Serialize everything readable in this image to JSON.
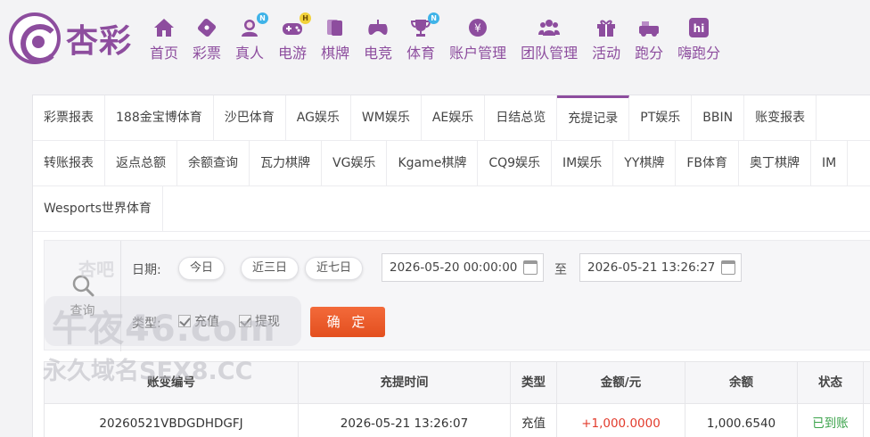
{
  "brand": {
    "name": "杏彩",
    "color": "#8d4d9e"
  },
  "nav": [
    {
      "label": "首页",
      "icon": "home-icon"
    },
    {
      "label": "彩票",
      "icon": "lottery-ticket-icon"
    },
    {
      "label": "真人",
      "icon": "live-dealer-icon",
      "badge": "N"
    },
    {
      "label": "电游",
      "icon": "gamepad-icon",
      "badge": "H"
    },
    {
      "label": "棋牌",
      "icon": "cards-icon"
    },
    {
      "label": "电竞",
      "icon": "esports-controller-icon"
    },
    {
      "label": "体育",
      "icon": "trophy-icon",
      "badge": "N"
    },
    {
      "label": "账户管理",
      "icon": "yen-coin-icon"
    },
    {
      "label": "团队管理",
      "icon": "team-icon"
    },
    {
      "label": "活动",
      "icon": "gift-icon"
    },
    {
      "label": "跑分",
      "icon": "race-icon"
    },
    {
      "label": "嗨跑分",
      "icon": "hi-app-icon"
    }
  ],
  "tabs": {
    "row1": [
      "彩票报表",
      "188金宝博体育",
      "沙巴体育",
      "AG娱乐",
      "WM娱乐",
      "AE娱乐",
      "日结总览",
      "充提记录",
      "PT娱乐",
      "BBIN",
      "账变报表"
    ],
    "row2": [
      "转账报表",
      "返点总额",
      "余额查询",
      "瓦力棋牌",
      "VG娱乐",
      "Kgame棋牌",
      "CQ9娱乐",
      "IM娱乐",
      "YY棋牌",
      "FB体育",
      "奥丁棋牌",
      "IM"
    ],
    "row3": [
      "Wesports世界体育"
    ],
    "active": "充提记录"
  },
  "filter": {
    "search_label": "查询",
    "date_label": "日期:",
    "quick": [
      "今日",
      "近三日",
      "近七日"
    ],
    "start": "2026-05-20 00:00:00",
    "to": "至",
    "end": "2026-05-21 13:26:27",
    "type_label": "类型:",
    "types": [
      {
        "label": "充值",
        "checked": true
      },
      {
        "label": "提现",
        "checked": true
      }
    ],
    "confirm_label": "确 定",
    "confirm_color": "#e8551f"
  },
  "table": {
    "columns": [
      "账变编号",
      "充提时间",
      "类型",
      "金额/元",
      "余额",
      "状态"
    ],
    "rows": [
      {
        "id": "20260521VBDGDHDGFJ",
        "time": "2026-05-21 13:26:07",
        "type": "充值",
        "amount": "+1,000.0000",
        "balance": "1,000.6540",
        "status": "已到账"
      }
    ]
  },
  "watermark": {
    "top": "杏吧",
    "big": "午夜46.com",
    "line": "永久域名SEX8.CC"
  }
}
